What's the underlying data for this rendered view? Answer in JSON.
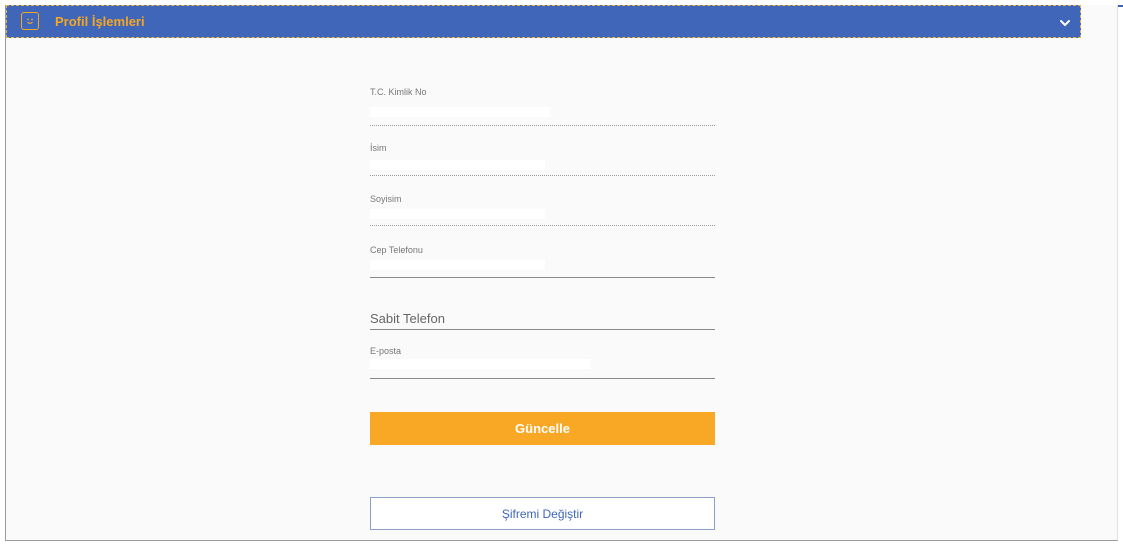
{
  "header": {
    "title": "Profil İşlemleri",
    "icon": "smile-icon",
    "toggle_icon": "chevron-down-icon"
  },
  "form": {
    "tc": {
      "label": "T.C. Kimlik No",
      "value": ""
    },
    "name": {
      "label": "İsim",
      "value": ""
    },
    "surname": {
      "label": "Soyisim",
      "value": ""
    },
    "mobile": {
      "label": "Cep Telefonu",
      "value": ""
    },
    "landline": {
      "placeholder": "Sabit Telefon"
    },
    "email": {
      "label": "E-posta",
      "value": ""
    }
  },
  "buttons": {
    "update": "Güncelle",
    "change_password": "Şifremi Değiştir"
  },
  "colors": {
    "header_bg": "#3f66b9",
    "accent": "#f9a825",
    "header_text": "#f5a623"
  }
}
